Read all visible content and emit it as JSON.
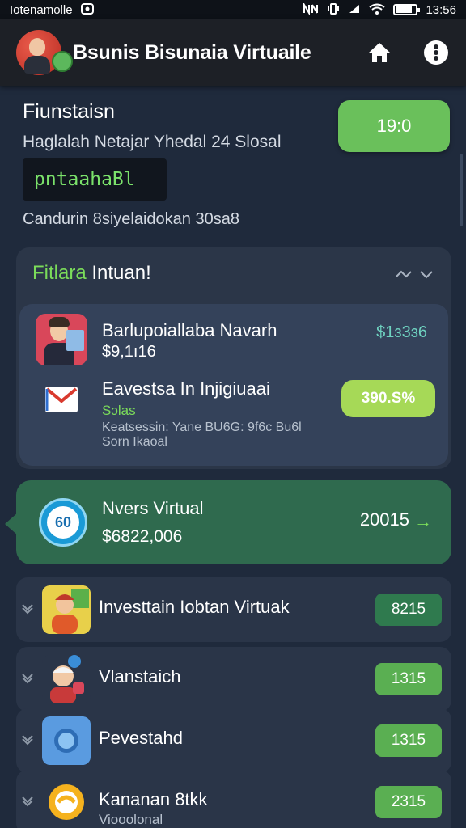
{
  "status_bar": {
    "carrier": "Iotenamolle",
    "time": "13:56",
    "battery_level": 0.8
  },
  "app_bar": {
    "title": "Bsunis Bisunaia Virtuaile",
    "home_icon": "home-icon",
    "more_icon": "more-vertical-icon"
  },
  "summary": {
    "title": "Fiunstaisn",
    "subtitle": "Haglalah Netajar Yhedal 24 Slosal",
    "code": "pntaahaBl",
    "footer": "Candurin 8siyelaidokan 30sa8",
    "button_label": "19:0"
  },
  "group": {
    "header_accent": "Fitlara",
    "header_text": "Intuan!",
    "item1": {
      "name": "Barlupoiallaba Navarh",
      "price": "$9,1ı16",
      "amount": "$1ɜ3ɜ6"
    },
    "item2": {
      "name": "Eavestsa In Injigiuaai",
      "sub": "Sɔlas",
      "desc_line1": "Keatsessin: Yane BU6G: 9f6c Bu6l",
      "desc_line2": "Sorn Ikaoal",
      "button_label": "390.S%"
    }
  },
  "highlight": {
    "logo_text": "60",
    "title": "Nvers Virtual",
    "sub": "$6822,006",
    "value": "20015",
    "arrow": "→"
  },
  "rows": [
    {
      "label": "Investtain Iobtan Virtuak",
      "sub": "",
      "badge": "8215"
    },
    {
      "label": "Vlanstaich",
      "sub": "",
      "badge": "1315"
    },
    {
      "label": "Pevestahd",
      "sub": "",
      "badge": "1315"
    },
    {
      "label": "Kananan 8tkk",
      "sub": "Viooolonal",
      "badge": "2315"
    }
  ],
  "colors": {
    "background": "#1f2a3c",
    "accent_green": "#6ac05b",
    "highlight_card": "#2f6a4e",
    "teal_amount": "#6fd3c1"
  }
}
